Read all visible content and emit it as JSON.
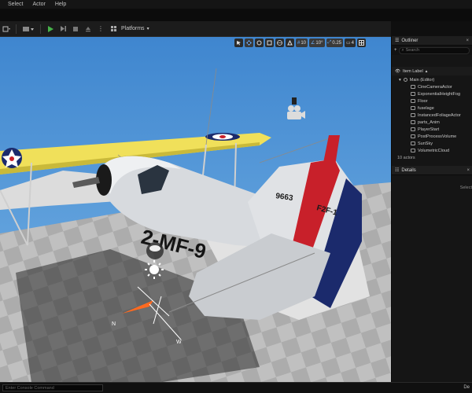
{
  "menu": {
    "items": [
      "Select",
      "Actor",
      "Help"
    ]
  },
  "toolbar": {
    "platforms_label": "Platforms"
  },
  "viewport": {
    "tools": {
      "grid_snap_value": "10",
      "rotate_snap_value": "10°",
      "scale_snap_value": "0.25",
      "camera_speed_value": "4"
    },
    "aircraft_marking": "2-MF-9",
    "tail_number": "9663",
    "tail_code": "F2F-1"
  },
  "outliner": {
    "title": "Outliner",
    "search_placeholder": "Search",
    "column_label": "Item Label",
    "root_item": "Main (Editor)",
    "items": [
      "CineCameraActor",
      "ExponentialHeightFog",
      "Floor",
      "fuselage",
      "InstancedFoliageActor",
      "parts_Anim",
      "PlayerStart",
      "PostProcessVolume",
      "SunSky",
      "VolumetricCloud"
    ],
    "count_text": "10 actors"
  },
  "details": {
    "title": "Details",
    "hint": "Select"
  },
  "status": {
    "console_placeholder": "Enter Console Command",
    "right_label": "De"
  },
  "colors": {
    "sky": "#4f95d6",
    "wing": "#f0e05a",
    "stripe_red": "#c8202a",
    "stripe_blue": "#1b2a6c"
  }
}
